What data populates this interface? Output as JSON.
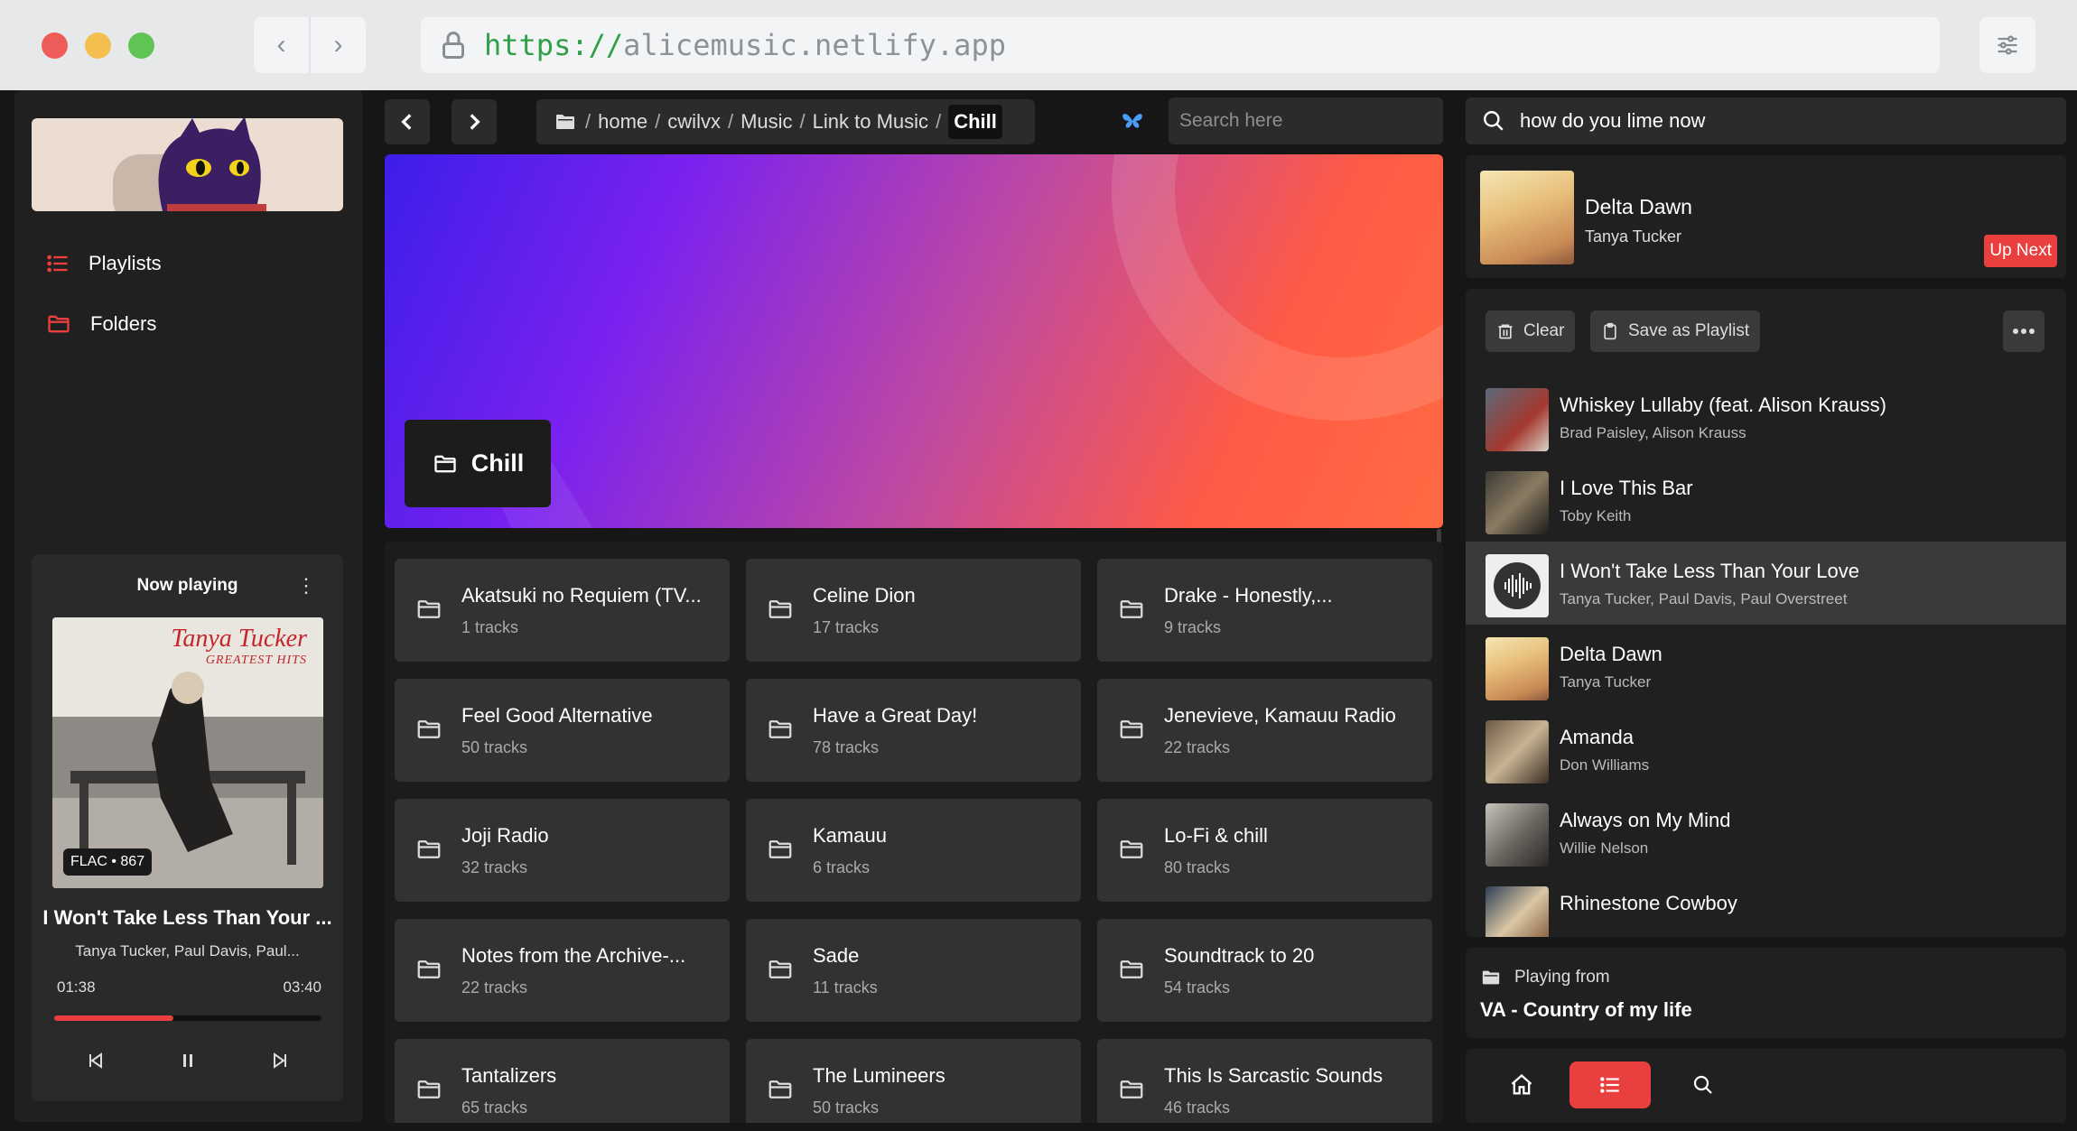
{
  "browser": {
    "url_scheme": "https://",
    "url_host": "alicemusic.netlify.app"
  },
  "sidebar": {
    "items": [
      {
        "label": "Playlists",
        "icon": "list-icon"
      },
      {
        "label": "Folders",
        "icon": "folder-icon"
      }
    ]
  },
  "now_playing": {
    "heading": "Now playing",
    "album_text": "Tanya Tucker",
    "album_subtext": "GREATEST HITS",
    "badge": "FLAC • 867",
    "track": "I Won't Take Less Than Your ...",
    "artist": "Tanya Tucker, Paul Davis, Paul...",
    "elapsed": "01:38",
    "duration": "03:40",
    "progress": 0.445
  },
  "toolbar": {
    "breadcrumbs": [
      "home",
      "cwilvx",
      "Music",
      "Link to Music"
    ],
    "current": "Chill",
    "search_placeholder": "Search here"
  },
  "banner": {
    "title": "Chill"
  },
  "folders": [
    {
      "name": "Akatsuki no Requiem (TV...",
      "count": "1 tracks"
    },
    {
      "name": "Celine Dion",
      "count": "17 tracks"
    },
    {
      "name": "Drake - Honestly,...",
      "count": "9 tracks"
    },
    {
      "name": "Feel Good Alternative",
      "count": "50 tracks"
    },
    {
      "name": "Have a Great Day!",
      "count": "78 tracks"
    },
    {
      "name": "Jenevieve, Kamauu Radio",
      "count": "22 tracks"
    },
    {
      "name": "Joji Radio",
      "count": "32 tracks"
    },
    {
      "name": "Kamauu",
      "count": "6 tracks"
    },
    {
      "name": "Lo-Fi & chill",
      "count": "80 tracks"
    },
    {
      "name": "Notes from the Archive-...",
      "count": "22 tracks"
    },
    {
      "name": "Sade",
      "count": "11 tracks"
    },
    {
      "name": "Soundtrack to 20",
      "count": "54 tracks"
    },
    {
      "name": "Tantalizers",
      "count": "65 tracks"
    },
    {
      "name": "The Lumineers",
      "count": "50 tracks"
    },
    {
      "name": "This Is Sarcastic Sounds",
      "count": "46 tracks"
    }
  ],
  "right": {
    "search_value": "how do you lime now",
    "up_next": {
      "title": "Delta Dawn",
      "artist": "Tanya Tucker",
      "badge": "Up Next"
    },
    "queue_actions": {
      "clear": "Clear",
      "save": "Save as Playlist"
    },
    "queue": [
      {
        "title": "Whiskey Lullaby (feat. Alison Krauss)",
        "artist": "Brad Paisley, Alison Krauss"
      },
      {
        "title": "I Love This Bar",
        "artist": "Toby Keith"
      },
      {
        "title": "I Won't Take Less Than Your Love",
        "artist": "Tanya Tucker, Paul Davis, Paul Overstreet"
      },
      {
        "title": "Delta Dawn",
        "artist": "Tanya Tucker"
      },
      {
        "title": "Amanda",
        "artist": "Don Williams"
      },
      {
        "title": "Always on My Mind",
        "artist": "Willie Nelson"
      },
      {
        "title": "Rhinestone Cowboy",
        "artist": ""
      }
    ],
    "playing_from": {
      "label": "Playing from",
      "name": "VA - Country of my life"
    }
  },
  "colors": {
    "accent": "#ea3f3f",
    "panel": "#202020",
    "card": "#323232"
  }
}
